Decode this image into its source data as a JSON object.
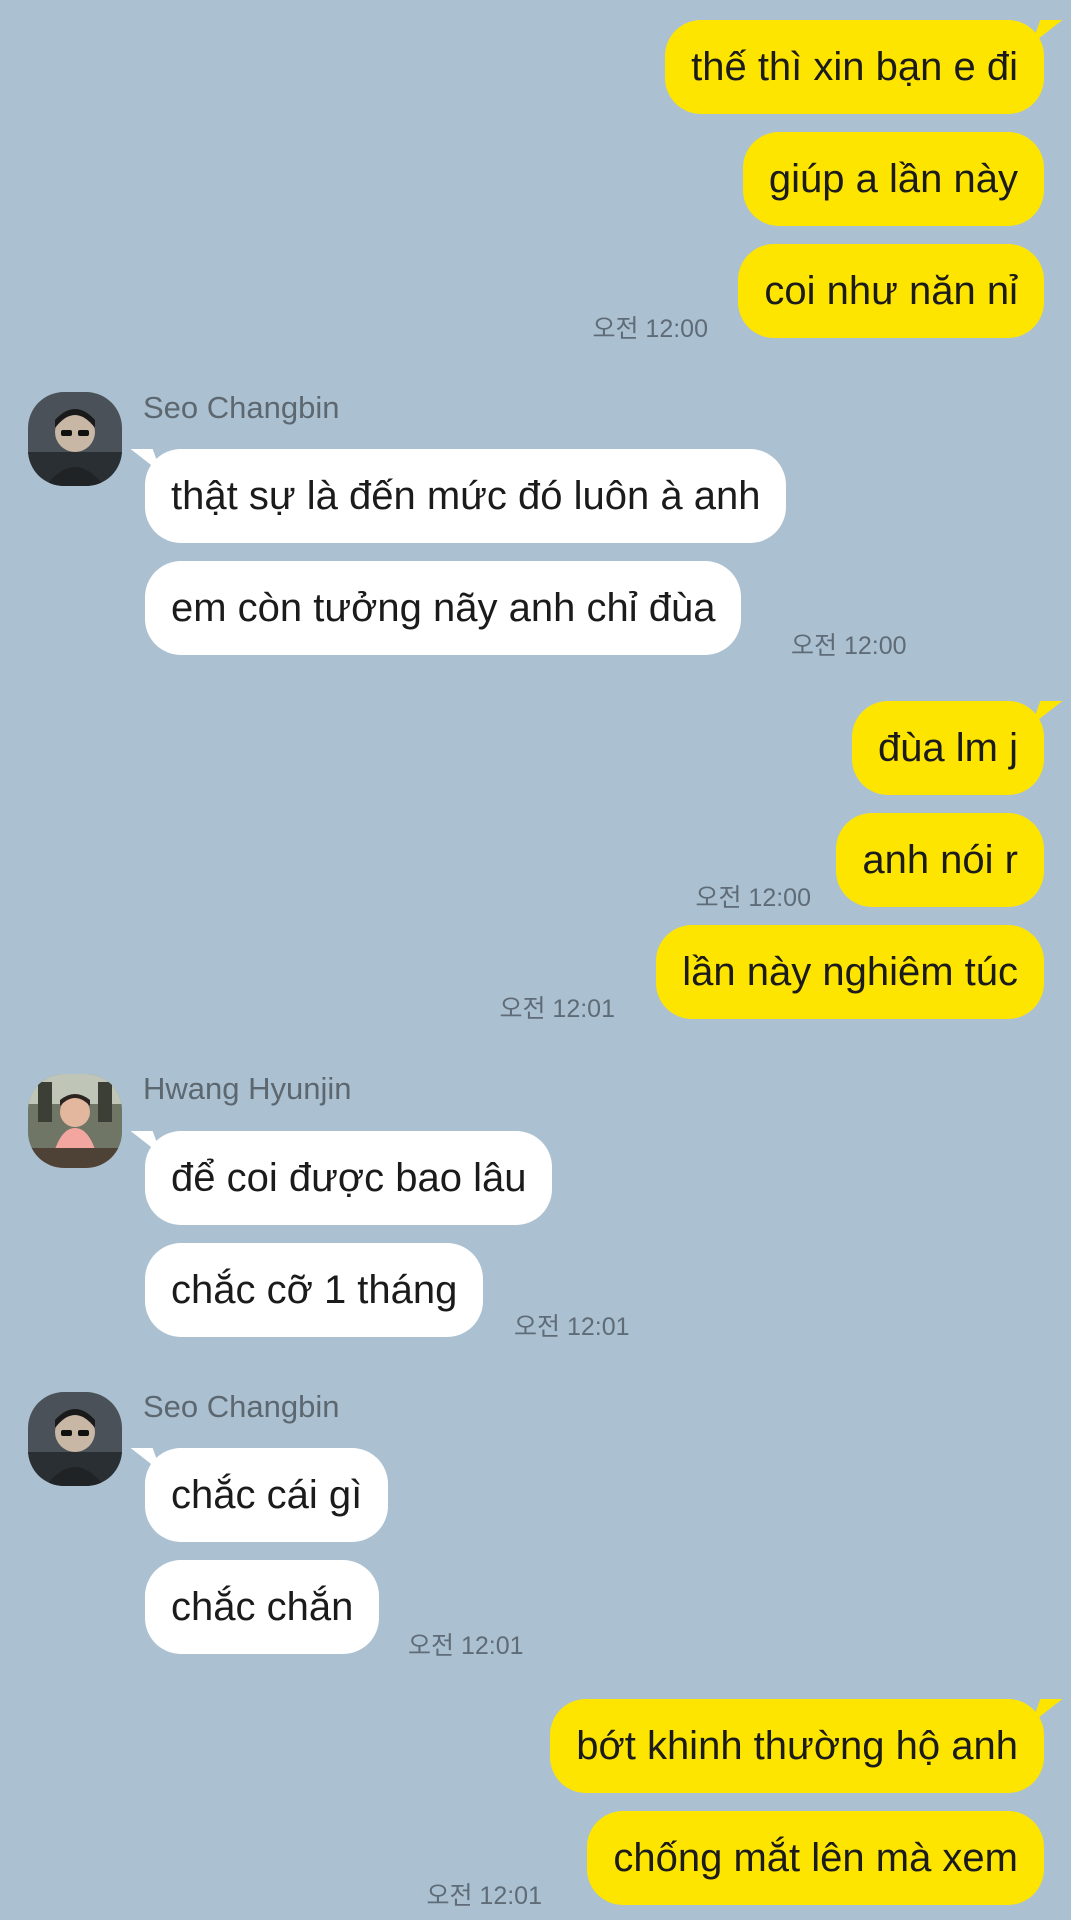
{
  "messages": {
    "m1": "thế thì xin bạn e đi",
    "m2": "giúp a lần này",
    "m3": "coi như năn nỉ",
    "m4": "thật sự là đến mức đó luôn à anh",
    "m5": "em còn tưởng nãy anh chỉ đùa",
    "m6": "đùa lm j",
    "m7": "anh nói r",
    "m8": "lần này nghiêm túc",
    "m9": "để coi được bao lâu",
    "m10": "chắc cỡ 1 tháng",
    "m11": "chắc cái gì",
    "m12": "chắc chắn",
    "m13": "bớt khinh thường hộ anh",
    "m14": "chống mắt lên mà xem"
  },
  "times": {
    "t1": "오전 12:00",
    "t2": "오전 12:00",
    "t3": "오전 12:00",
    "t4": "오전 12:01",
    "t5": "오전 12:01",
    "t6": "오전 12:01",
    "t7": "오전 12:01"
  },
  "senders": {
    "s1": "Seo Changbin",
    "s2": "Hwang Hyunjin",
    "s3": "Seo Changbin"
  },
  "colors": {
    "background": "#abc1d1",
    "outgoing_bubble": "#fee500",
    "incoming_bubble": "#ffffff",
    "time_text": "#5f6c77"
  },
  "icons": {
    "avatar_changbin": "avatar-changbin-icon",
    "avatar_hyunjin": "avatar-hyunjin-icon"
  }
}
